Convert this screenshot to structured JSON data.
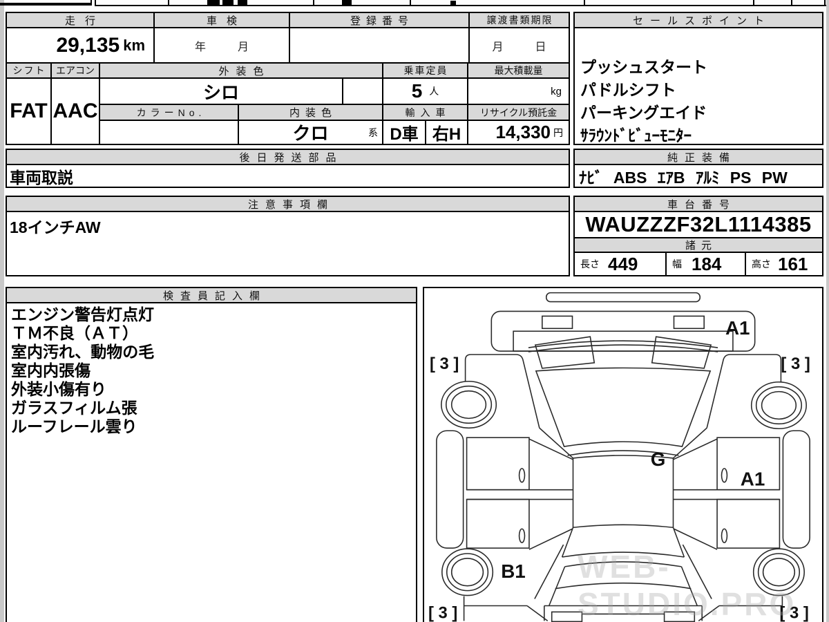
{
  "colors": {
    "header_bg": "#d9d9d9",
    "border": "#000000",
    "page_edge": "#c9c9c9",
    "text": "#000000"
  },
  "table": {
    "mileage": {
      "label": "走行",
      "value": "29,135",
      "unit": "km"
    },
    "inspection": {
      "label": "車検",
      "placeholder_year": "年",
      "placeholder_month": "月"
    },
    "registration": {
      "label": "登録番号",
      "value": ""
    },
    "transfer_docs": {
      "label": "譲渡書類期限",
      "placeholder_month": "月",
      "placeholder_day": "日"
    },
    "shift": {
      "label": "シフト",
      "value": "FAT"
    },
    "aircon": {
      "label": "エアコン",
      "value": "AAC"
    },
    "exterior_color": {
      "label": "外装色",
      "value": "シロ"
    },
    "capacity": {
      "label": "乗車定員",
      "value": "5",
      "unit": "人"
    },
    "max_load": {
      "label": "最大積載量",
      "value": "",
      "unit": "kg"
    },
    "color_no": {
      "label": "カラーNo.",
      "value": ""
    },
    "interior_color": {
      "label": "内装色",
      "value": "クロ",
      "suffix": "系"
    },
    "import_car": {
      "label": "輸入車",
      "type": "D車",
      "handle": "右H"
    },
    "recycle_fee": {
      "label": "リサイクル預託金",
      "value": "14,330",
      "unit": "円"
    },
    "shipped_later": {
      "label": "後日発送部品",
      "value": "車両取説"
    },
    "notes": {
      "label": "注意事項欄",
      "value": "18インチAW"
    }
  },
  "sales_points": {
    "label": "セールスポイント",
    "items": [
      "プッシュスタート",
      "パドルシフト",
      "パーキングエイド",
      "ｻﾗｳﾝﾄﾞﾋﾞｭｰﾓﾆﾀｰ"
    ]
  },
  "equipment": {
    "label": "純正装備",
    "value": "ﾅﾋﾞ ABS ｴｱB ｱﾙﾐ PS PW"
  },
  "chassis_no": {
    "label": "車台番号",
    "value": "WAUZZZF32L1114385"
  },
  "dimensions": {
    "label": "諸元",
    "length_label": "長さ",
    "length": "449",
    "width_label": "幅",
    "width": "184",
    "height_label": "高さ",
    "height": "161"
  },
  "inspector": {
    "label": "検査員記入欄",
    "lines": [
      "エンジン警告灯点灯",
      "ＴＭ不良（ＡＴ）",
      "室内汚れ、動物の毛",
      "室内内張傷",
      "外装小傷有り",
      "ガラスフィルム張",
      "ルーフレール雲り"
    ]
  },
  "diagram": {
    "front_bumper_grade": "A1",
    "windshield_grade": "G",
    "right_front_door_grade": "A1",
    "left_rear_quarter_grade": "B1",
    "tire_front_left": "[ 3 ]",
    "tire_front_right": "[ 3 ]",
    "tire_rear_left": "[ 3 ]",
    "tire_rear_right": "[ 3 ]"
  },
  "watermark": "WEB-STUDIO.PRO"
}
